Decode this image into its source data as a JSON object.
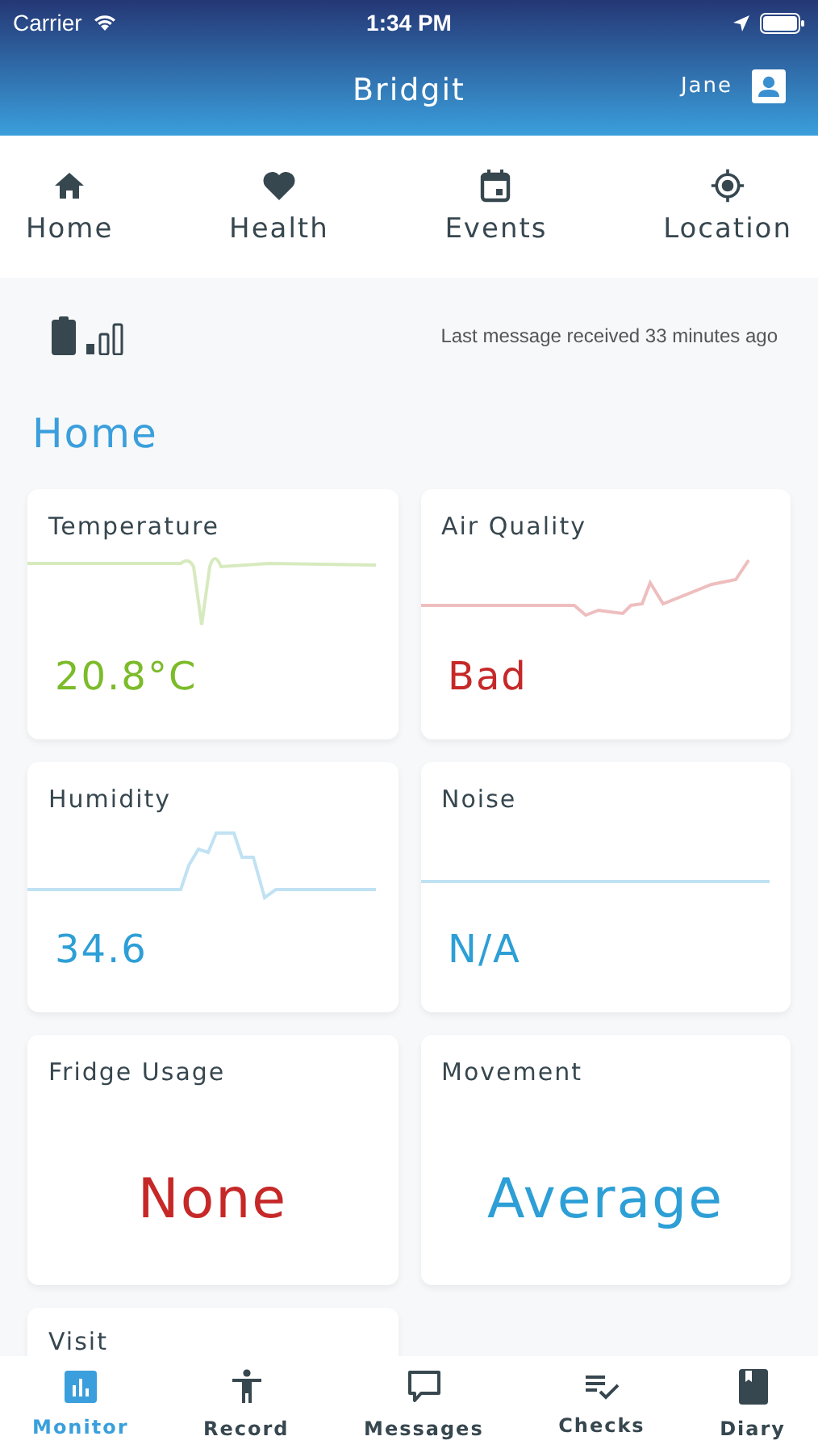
{
  "status_bar": {
    "carrier": "Carrier",
    "time": "1:34 PM"
  },
  "header": {
    "title": "Bridgit",
    "user": "Jane"
  },
  "tabs": [
    {
      "label": "Home"
    },
    {
      "label": "Health"
    },
    {
      "label": "Events"
    },
    {
      "label": "Location"
    }
  ],
  "device_status": {
    "message": "Last message received 33 minutes ago"
  },
  "section_title": "Home",
  "cards": [
    {
      "kind": "trend",
      "title": "Temperature",
      "value": "20.8°C",
      "color": "#7cbb2a"
    },
    {
      "kind": "trend",
      "title": "Air Quality",
      "value": "Bad",
      "color": "#c62828"
    },
    {
      "kind": "trend",
      "title": "Humidity",
      "value": "34.6",
      "color": "#2d9fd6"
    },
    {
      "kind": "trend",
      "title": "Noise",
      "value": "N/A",
      "color": "#2d9fd6"
    },
    {
      "kind": "large",
      "title": "Fridge Usage",
      "value": "None",
      "color": "#c62828"
    },
    {
      "kind": "large",
      "title": "Movement",
      "value": "Average",
      "color": "#2d9fd6"
    },
    {
      "kind": "peek",
      "title": "Visit"
    }
  ],
  "bottom_nav": [
    {
      "label": "Monitor",
      "selected": true
    },
    {
      "label": "Record",
      "selected": false
    },
    {
      "label": "Messages",
      "selected": false
    },
    {
      "label": "Checks",
      "selected": false
    },
    {
      "label": "Diary",
      "selected": false
    }
  ]
}
